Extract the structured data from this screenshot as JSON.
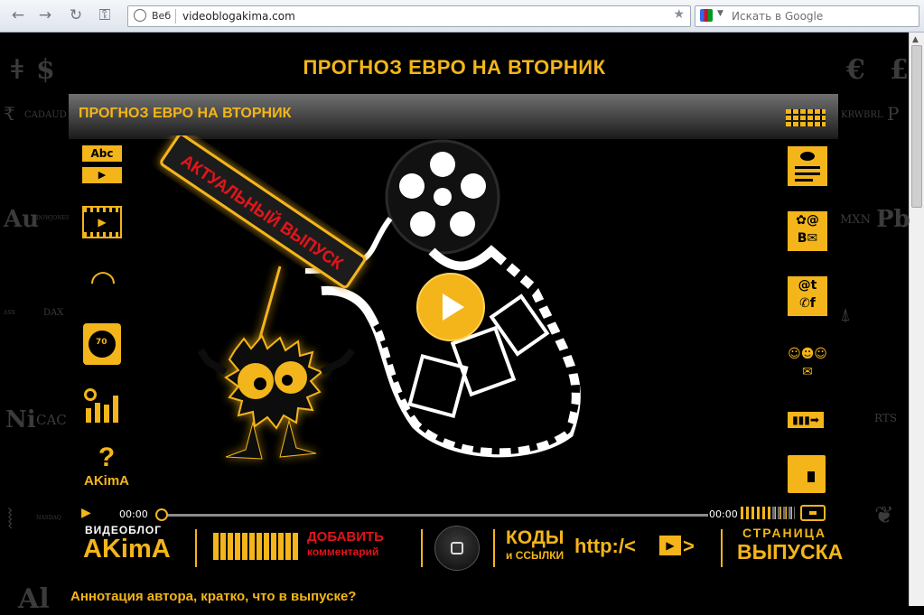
{
  "browser": {
    "omnibox_chip": "Веб",
    "url": "videoblogakima.com",
    "search_placeholder": "Искать в Google"
  },
  "background_symbols": {
    "left": [
      "$",
      "₹",
      "CAD",
      "AUD",
      "Au",
      "DOWJONES",
      "ASX",
      "DAX",
      "Ni",
      "CAC",
      "NASDAQ",
      "Al"
    ],
    "right": [
      "€",
      "£",
      "KRW",
      "BRL",
      "P",
      "MXN",
      "Pb",
      "RTS"
    ]
  },
  "page_title": "ПРОГНОЗ ЕВРО НА ВТОРНИК",
  "player": {
    "title": "ПРОГНОЗ ЕВРО НА ВТОРНИК",
    "left_icons": [
      "abc-play-icon",
      "film-icon",
      "headphones-icon",
      "stopwatch-icon",
      "chart-icon",
      "question-icon"
    ],
    "abc_label": "Abc",
    "stopwatch_value": "70",
    "help_label": "?",
    "help_caption": "AKimA",
    "right_icons": [
      "eye-doc-icon",
      "social-icon",
      "email-social-icon",
      "mail-people-icon",
      "arrow-icon",
      "folder-icon"
    ],
    "sign_text": "АКТУАЛЬНЫЙ ВЫПУСК",
    "time_current": "00:00",
    "time_total": "00:00",
    "progress": 0,
    "volume_level": 0.6,
    "bottom": {
      "brand_line1": "ВИДЕОБЛОГ",
      "brand_line2": "AKimA",
      "add_line1": "ДОБАВИТЬ",
      "add_line2": "комментарий",
      "codes_line1": "КОДЫ",
      "codes_line2": "и ССЫЛКИ",
      "http_label": "http:/<",
      "http_suffix": ">",
      "page_line1": "СТРАНИЦА",
      "page_line2": "ВЫПУСКА"
    }
  },
  "annotation": "Аннотация автора, кратко, что в выпуске?",
  "colors": {
    "accent": "#f3b51a",
    "red": "#e0141a"
  }
}
